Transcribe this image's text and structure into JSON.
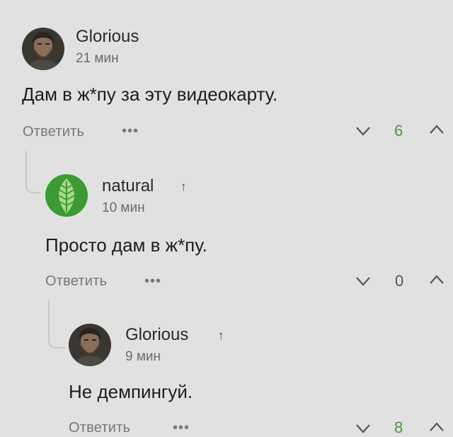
{
  "comments": [
    {
      "username": "Glorious",
      "time": "21 мин",
      "text": "Дам в ж*пу за эту видеокарту.",
      "reply_label": "Ответить",
      "more_label": "•••",
      "score": "6",
      "score_color": "#4a9a3a",
      "avatar": "person-avatar",
      "op_marker": ""
    },
    {
      "username": "natural",
      "time": "10 мин",
      "text": "Просто дам в ж*пу.",
      "reply_label": "Ответить",
      "more_label": "•••",
      "score": "0",
      "score_color": "#555555",
      "avatar": "leaf-avatar",
      "op_marker": "↑"
    },
    {
      "username": "Glorious",
      "time": "9 мин",
      "text": "Не демпингуй.",
      "reply_label": "Ответить",
      "more_label": "•••",
      "score": "8",
      "score_color": "#4a9a3a",
      "avatar": "person-avatar",
      "op_marker": "↑"
    }
  ]
}
